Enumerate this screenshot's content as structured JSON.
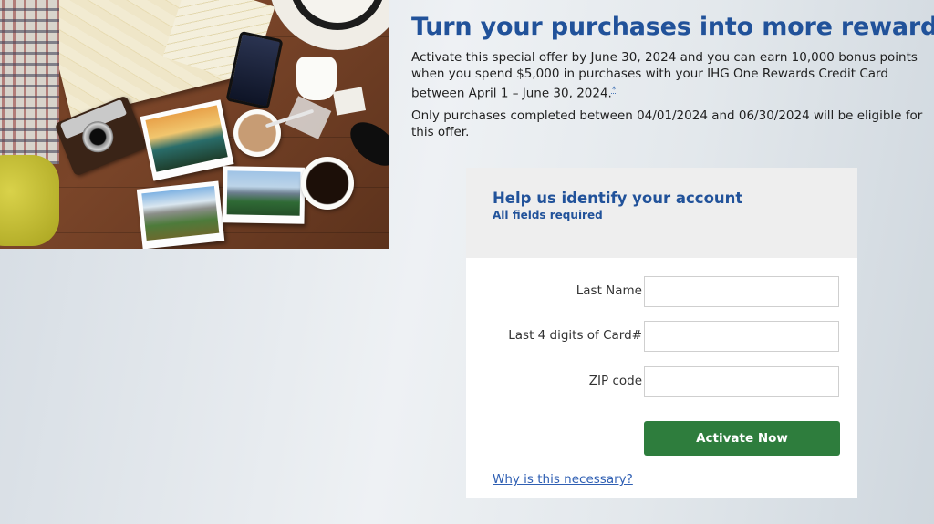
{
  "promo": {
    "headline": "Turn your purchases into more rewards!",
    "description": "Activate this special offer by June 30, 2024 and you can earn 10,000 bonus points when you spend $5,000 in purchases with your IHG One Rewards Credit Card between April 1 – June 30, 2024.",
    "footnote_marker": "*",
    "eligibility": "Only purchases completed between 04/01/2024 and 06/30/2024 will be eligible for this offer."
  },
  "form": {
    "title": "Help us identify your account",
    "subtitle": "All fields required",
    "fields": [
      {
        "label": "Last Name",
        "value": "",
        "placeholder": ""
      },
      {
        "label": "Last 4 digits of Card#",
        "value": "",
        "placeholder": ""
      },
      {
        "label": "ZIP code",
        "value": "",
        "placeholder": ""
      }
    ],
    "submit_label": "Activate Now",
    "help_link": "Why is this necessary?"
  },
  "colors": {
    "headline_blue": "#21529a",
    "button_green": "#2e7d3d",
    "link_blue": "#2f5fb3",
    "card_header_gray": "#eeeeee"
  }
}
